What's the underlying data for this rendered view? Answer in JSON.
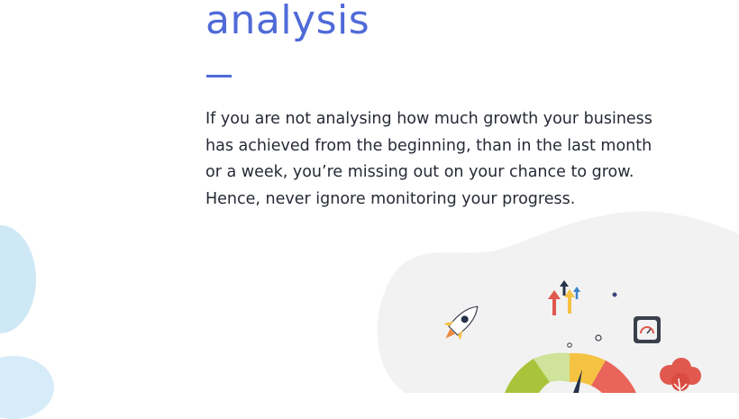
{
  "heading": "analysis",
  "body": "If you are not analysing how much growth your business has achieved from the beginning, than in the last month or a week, you’re missing out on your chance to grow. Hence, never ignore monitoring your progress.",
  "colors": {
    "heading": "#4f6ad8",
    "accent": "#4f6ad8",
    "text": "#262a35",
    "blob": "#f2f2f2",
    "left_blob": "#cfe8f5"
  },
  "illustration": {
    "icons": [
      "rocket-icon",
      "growth-arrows-icon",
      "speedometer-chip-icon",
      "brain-tree-icon",
      "gauge-icon"
    ]
  }
}
